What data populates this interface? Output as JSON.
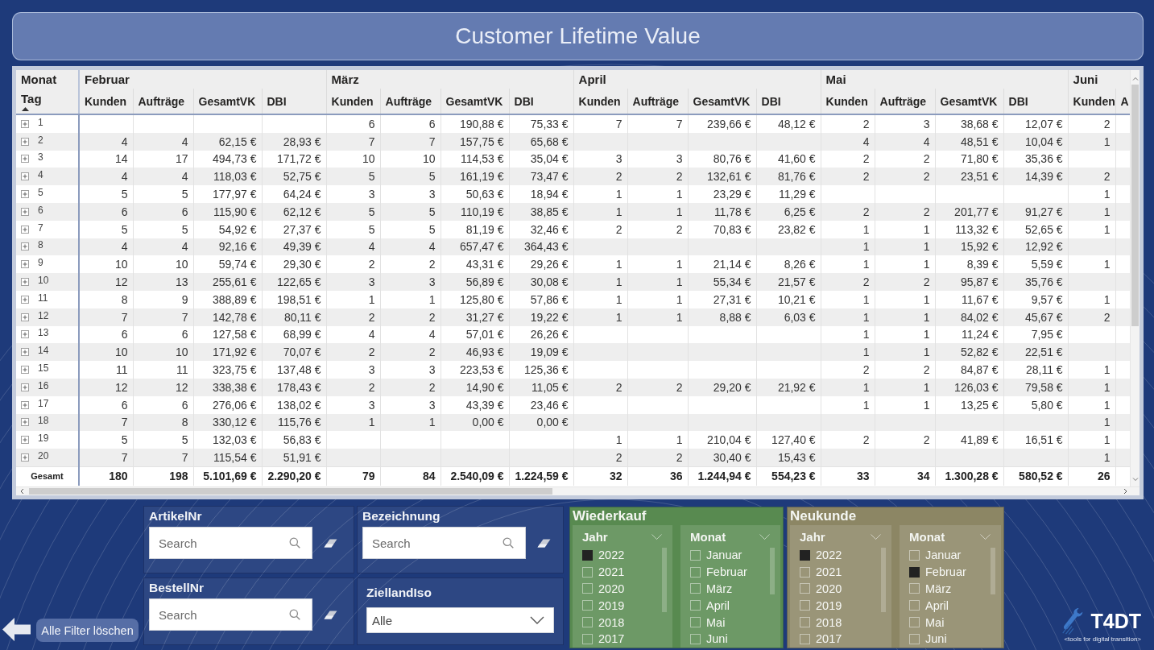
{
  "title": "Customer Lifetime Value",
  "table": {
    "row_group_header": "Monat",
    "row_header": "Tag",
    "sort_ascending": true,
    "months": [
      {
        "name": "Februar",
        "columns": [
          "Kunden",
          "Aufträge",
          "GesamtVK",
          "DBI"
        ]
      },
      {
        "name": "März",
        "columns": [
          "Kunden",
          "Aufträge",
          "GesamtVK",
          "DBI"
        ]
      },
      {
        "name": "April",
        "columns": [
          "Kunden",
          "Aufträge",
          "GesamtVK",
          "DBI"
        ]
      },
      {
        "name": "Mai",
        "columns": [
          "Kunden",
          "Aufträge",
          "GesamtVK",
          "DBI"
        ]
      },
      {
        "name": "Juni",
        "columns": [
          "Kunden",
          "A"
        ]
      }
    ],
    "rows": [
      {
        "day": "1",
        "expanded": false,
        "cells": [
          null,
          null,
          null,
          null,
          "6",
          "6",
          "190,88 €",
          "75,33 €",
          "7",
          "7",
          "239,66 €",
          "48,12 €",
          "2",
          "3",
          "38,68 €",
          "12,07 €",
          "2",
          null
        ]
      },
      {
        "day": "2",
        "expanded": false,
        "cells": [
          "4",
          "4",
          "62,15 €",
          "28,93 €",
          "7",
          "7",
          "157,75 €",
          "65,68 €",
          null,
          null,
          null,
          null,
          "4",
          "4",
          "48,51 €",
          "10,04 €",
          "1",
          null
        ]
      },
      {
        "day": "3",
        "expanded": false,
        "cells": [
          "14",
          "17",
          "494,73 €",
          "171,72 €",
          "10",
          "10",
          "114,53 €",
          "35,04 €",
          "3",
          "3",
          "80,76 €",
          "41,60 €",
          "2",
          "2",
          "71,80 €",
          "35,36 €",
          null,
          null
        ]
      },
      {
        "day": "4",
        "expanded": false,
        "cells": [
          "4",
          "4",
          "118,03 €",
          "52,75 €",
          "5",
          "5",
          "161,19 €",
          "73,47 €",
          "2",
          "2",
          "132,61 €",
          "81,76 €",
          "2",
          "2",
          "23,51 €",
          "14,39 €",
          "2",
          null
        ]
      },
      {
        "day": "5",
        "expanded": false,
        "cells": [
          "5",
          "5",
          "177,97 €",
          "64,24 €",
          "3",
          "3",
          "50,63 €",
          "18,94 €",
          "1",
          "1",
          "23,29 €",
          "11,29 €",
          null,
          null,
          null,
          null,
          "1",
          null
        ]
      },
      {
        "day": "6",
        "expanded": false,
        "cells": [
          "6",
          "6",
          "115,90 €",
          "62,12 €",
          "5",
          "5",
          "110,19 €",
          "38,85 €",
          "1",
          "1",
          "11,78 €",
          "6,25 €",
          "2",
          "2",
          "201,77 €",
          "91,27 €",
          "1",
          null
        ]
      },
      {
        "day": "7",
        "expanded": false,
        "cells": [
          "5",
          "5",
          "54,92 €",
          "27,37 €",
          "5",
          "5",
          "81,19 €",
          "32,46 €",
          "2",
          "2",
          "70,83 €",
          "23,82 €",
          "1",
          "1",
          "113,32 €",
          "52,65 €",
          "1",
          null
        ]
      },
      {
        "day": "8",
        "expanded": false,
        "cells": [
          "4",
          "4",
          "92,16 €",
          "49,39 €",
          "4",
          "4",
          "657,47 €",
          "364,43 €",
          null,
          null,
          null,
          null,
          "1",
          "1",
          "15,92 €",
          "12,92 €",
          null,
          null
        ]
      },
      {
        "day": "9",
        "expanded": false,
        "cells": [
          "10",
          "10",
          "59,74 €",
          "29,30 €",
          "2",
          "2",
          "43,31 €",
          "29,26 €",
          "1",
          "1",
          "21,14 €",
          "8,26 €",
          "1",
          "1",
          "8,39 €",
          "5,59 €",
          "1",
          null
        ]
      },
      {
        "day": "10",
        "expanded": false,
        "cells": [
          "12",
          "13",
          "255,61 €",
          "122,65 €",
          "3",
          "3",
          "56,89 €",
          "30,08 €",
          "1",
          "1",
          "55,34 €",
          "21,57 €",
          "2",
          "2",
          "95,87 €",
          "35,76 €",
          null,
          null
        ]
      },
      {
        "day": "11",
        "expanded": false,
        "cells": [
          "8",
          "9",
          "388,89 €",
          "198,51 €",
          "1",
          "1",
          "125,80 €",
          "57,86 €",
          "1",
          "1",
          "27,31 €",
          "10,21 €",
          "1",
          "1",
          "11,67 €",
          "9,57 €",
          "1",
          null
        ]
      },
      {
        "day": "12",
        "expanded": false,
        "cells": [
          "7",
          "7",
          "142,78 €",
          "80,11 €",
          "2",
          "2",
          "31,27 €",
          "19,22 €",
          "1",
          "1",
          "8,88 €",
          "6,03 €",
          "1",
          "1",
          "84,02 €",
          "45,67 €",
          "2",
          null
        ]
      },
      {
        "day": "13",
        "expanded": false,
        "cells": [
          "6",
          "6",
          "127,58 €",
          "68,99 €",
          "4",
          "4",
          "57,01 €",
          "26,26 €",
          null,
          null,
          null,
          null,
          "1",
          "1",
          "11,24 €",
          "7,95 €",
          null,
          null
        ]
      },
      {
        "day": "14",
        "expanded": false,
        "cells": [
          "10",
          "10",
          "171,92 €",
          "70,07 €",
          "2",
          "2",
          "46,93 €",
          "19,09 €",
          null,
          null,
          null,
          null,
          "1",
          "1",
          "52,82 €",
          "22,51 €",
          null,
          null
        ]
      },
      {
        "day": "15",
        "expanded": false,
        "cells": [
          "11",
          "11",
          "323,75 €",
          "137,48 €",
          "3",
          "3",
          "223,53 €",
          "125,36 €",
          null,
          null,
          null,
          null,
          "2",
          "2",
          "84,87 €",
          "28,11 €",
          "1",
          null
        ]
      },
      {
        "day": "16",
        "expanded": false,
        "cells": [
          "12",
          "12",
          "338,38 €",
          "178,43 €",
          "2",
          "2",
          "14,90 €",
          "11,05 €",
          "2",
          "2",
          "29,20 €",
          "21,92 €",
          "1",
          "1",
          "126,03 €",
          "79,58 €",
          "1",
          null
        ]
      },
      {
        "day": "17",
        "expanded": false,
        "cells": [
          "6",
          "6",
          "276,06 €",
          "138,02 €",
          "3",
          "3",
          "43,39 €",
          "23,46 €",
          null,
          null,
          null,
          null,
          "1",
          "1",
          "13,25 €",
          "5,80 €",
          "1",
          null
        ]
      },
      {
        "day": "18",
        "expanded": false,
        "cells": [
          "7",
          "8",
          "330,12 €",
          "115,76 €",
          "1",
          "1",
          "0,00 €",
          "0,00 €",
          null,
          null,
          null,
          null,
          null,
          null,
          null,
          null,
          "1",
          null
        ]
      },
      {
        "day": "19",
        "expanded": false,
        "cells": [
          "5",
          "5",
          "132,03 €",
          "56,83 €",
          null,
          null,
          null,
          null,
          "1",
          "1",
          "210,04 €",
          "127,40 €",
          "2",
          "2",
          "41,89 €",
          "16,51 €",
          "1",
          null
        ]
      },
      {
        "day": "20",
        "expanded": false,
        "cells": [
          "7",
          "7",
          "115,54 €",
          "51,91 €",
          null,
          null,
          null,
          null,
          "2",
          "2",
          "30,40 €",
          "15,43 €",
          null,
          null,
          null,
          null,
          "1",
          null
        ]
      }
    ],
    "total": {
      "label": "Gesamt",
      "cells": [
        "180",
        "198",
        "5.101,69 €",
        "2.290,20 €",
        "79",
        "84",
        "2.540,09 €",
        "1.224,59 €",
        "32",
        "36",
        "1.244,94 €",
        "554,23 €",
        "33",
        "34",
        "1.300,28 €",
        "580,52 €",
        "26",
        null
      ]
    }
  },
  "filters": {
    "clear_button": "Alle Filter löschen",
    "slicers": [
      {
        "kind": "search",
        "title": "ArtikelNr",
        "placeholder": "Search"
      },
      {
        "kind": "search",
        "title": "Bezeichnung",
        "placeholder": "Search"
      },
      {
        "kind": "search",
        "title": "BestellNr",
        "placeholder": "Search"
      },
      {
        "kind": "dropdown",
        "title": "ZiellandIso",
        "value": "Alle"
      }
    ]
  },
  "segments": [
    {
      "title": "Wiederkauf",
      "color": "#588a50",
      "lists": [
        {
          "title": "Jahr",
          "items": [
            {
              "label": "2022",
              "checked": true
            },
            {
              "label": "2021",
              "checked": false
            },
            {
              "label": "2020",
              "checked": false
            },
            {
              "label": "2019",
              "checked": false
            },
            {
              "label": "2018",
              "checked": false
            },
            {
              "label": "2017",
              "checked": false
            }
          ]
        },
        {
          "title": "Monat",
          "items": [
            {
              "label": "Januar",
              "checked": false
            },
            {
              "label": "Februar",
              "checked": false
            },
            {
              "label": "März",
              "checked": false
            },
            {
              "label": "April",
              "checked": false
            },
            {
              "label": "Mai",
              "checked": false
            },
            {
              "label": "Juni",
              "checked": false
            }
          ]
        }
      ]
    },
    {
      "title": "Neukunde",
      "color": "#8c8664",
      "lists": [
        {
          "title": "Jahr",
          "items": [
            {
              "label": "2022",
              "checked": true
            },
            {
              "label": "2021",
              "checked": false
            },
            {
              "label": "2020",
              "checked": false
            },
            {
              "label": "2019",
              "checked": false
            },
            {
              "label": "2018",
              "checked": false
            },
            {
              "label": "2017",
              "checked": false
            }
          ]
        },
        {
          "title": "Monat",
          "items": [
            {
              "label": "Januar",
              "checked": false
            },
            {
              "label": "Februar",
              "checked": true
            },
            {
              "label": "März",
              "checked": false
            },
            {
              "label": "April",
              "checked": false
            },
            {
              "label": "Mai",
              "checked": false
            },
            {
              "label": "Juni",
              "checked": false
            }
          ]
        }
      ]
    }
  ],
  "logo": {
    "name": "T4DT",
    "tagline": "<tools for digital transition>"
  }
}
